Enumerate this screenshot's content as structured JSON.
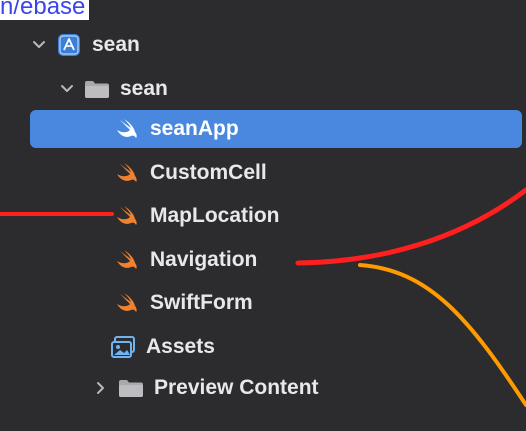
{
  "header": {
    "fragment_text": "n/ebase"
  },
  "navigator": {
    "items": [
      {
        "label": "sean",
        "icon": "xcode-project-icon",
        "chevron": "chevron-down-icon",
        "selected": false
      },
      {
        "label": "sean",
        "icon": "folder-icon",
        "chevron": "chevron-down-icon",
        "selected": false
      },
      {
        "label": "seanApp",
        "icon": "swift-file-icon",
        "chevron": "",
        "selected": true
      },
      {
        "label": "CustomCell",
        "icon": "swift-file-icon",
        "chevron": "",
        "selected": false
      },
      {
        "label": "MapLocation",
        "icon": "swift-file-icon",
        "chevron": "",
        "selected": false
      },
      {
        "label": "Navigation",
        "icon": "swift-file-icon",
        "chevron": "",
        "selected": false
      },
      {
        "label": "SwiftForm",
        "icon": "swift-file-icon",
        "chevron": "",
        "selected": false
      },
      {
        "label": "Assets",
        "icon": "asset-catalog-icon",
        "chevron": "",
        "selected": false
      },
      {
        "label": "Preview Content",
        "icon": "folder-icon",
        "chevron": "chevron-right-icon",
        "selected": false
      }
    ]
  },
  "colors": {
    "background": "#2c2c2e",
    "selection": "#4a88e0",
    "swift_orange": "#f0812e",
    "annotation_red": "#ff1f1f",
    "annotation_orange": "#ff9a00",
    "folder_gray": "#a9a9ad"
  }
}
